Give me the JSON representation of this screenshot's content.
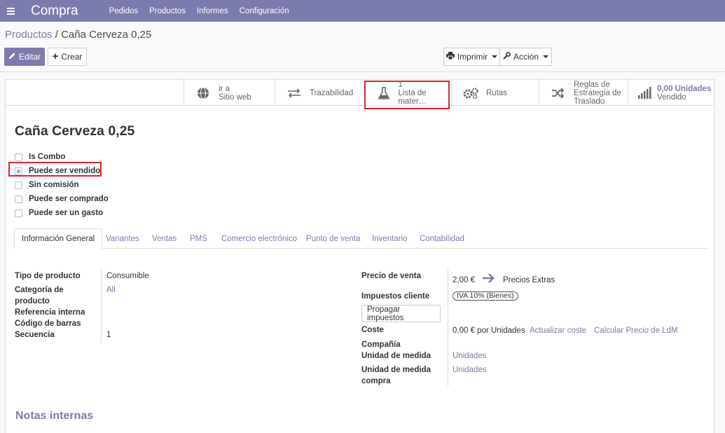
{
  "navbar": {
    "app_title": "Compra",
    "menu": [
      "Pedidos",
      "Productos",
      "Informes",
      "Configuración"
    ]
  },
  "breadcrumb": {
    "parent": "Productos",
    "separator": " / ",
    "current": "Caña Cerveza 0,25"
  },
  "toolbar": {
    "edit_label": "Editar",
    "create_label": "Crear",
    "print_label": "Imprimir",
    "action_label": "Acción"
  },
  "smart_buttons": {
    "website": {
      "line1": "ir a",
      "line2": "Sitio web",
      "icon": "globe-icon"
    },
    "traceability": {
      "label": "Trazabilidad",
      "icon": "exchange-icon"
    },
    "bom": {
      "count": "1",
      "label": "Lista de mater…",
      "icon": "flask-icon"
    },
    "routes": {
      "label": "Rutas",
      "icon": "cogs-icon"
    },
    "putaway": {
      "line1": "Reglas de",
      "line2": "Estrategia de",
      "line3": "Traslado",
      "icon": "random-icon"
    },
    "sold": {
      "value": "0,00 Unidades",
      "label": "Vendido",
      "icon": "signal-icon"
    }
  },
  "product": {
    "name": "Caña Cerveza 0,25",
    "checkboxes": [
      {
        "label": "Is Combo",
        "checked": false
      },
      {
        "label": "Puede ser vendido",
        "checked": true
      },
      {
        "label": "Sin comisión",
        "checked": false
      },
      {
        "label": "Puede ser comprado",
        "checked": false
      },
      {
        "label": "Puede ser un gasto",
        "checked": false
      }
    ]
  },
  "tabs": [
    "Información General",
    "Variantes",
    "Ventas",
    "PMS",
    "Comercio electrónico",
    "Punto de venta",
    "Inventario",
    "Contabilidad"
  ],
  "general": {
    "product_type_label": "Tipo de producto",
    "product_type": "Consumible",
    "category_label": "Categoría de producto",
    "category": "All",
    "internal_ref_label": "Referencia interna",
    "barcode_label": "Código de barras",
    "sequence_label": "Secuencia",
    "sequence": "1",
    "sale_price_label": "Precio de venta",
    "sale_price": "2,00 €",
    "extra_prices": "Precios Extras",
    "customer_taxes_label": "Impuestos cliente",
    "customer_tax": "IVA 10% (Bienes)",
    "propagate_taxes": "Propagar impuestos",
    "cost_label": "Coste",
    "cost": "0,00 € por Unidades",
    "update_cost": "Actualizar coste",
    "compute_bom_price": "Calcular Precio de LdM",
    "company_label": "Compañía",
    "uom_label": "Unidad de medida",
    "uom": "Unidades",
    "purchase_uom_label": "Unidad de medida compra",
    "purchase_uom": "Unidades"
  },
  "notes": {
    "title": "Notas internas"
  },
  "colors": {
    "brand": "#7c7bad",
    "highlight": "#d9262b"
  }
}
